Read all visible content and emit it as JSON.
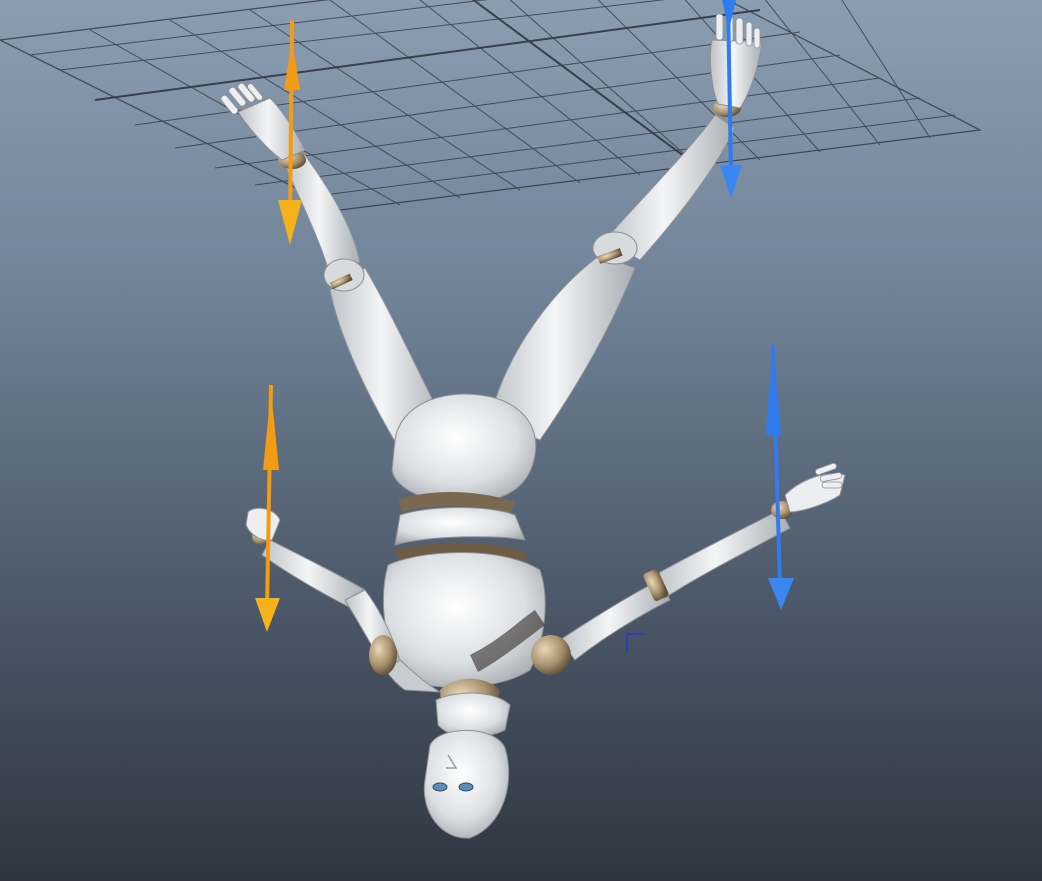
{
  "viewport": {
    "background_top": "#8b9db1",
    "background_bottom": "#2f3640",
    "grid_color": "#3a4048"
  },
  "figure": {
    "body_color": "#e6e8ea",
    "joint_color": "#8c7a62",
    "eye_color": "#5b8fb8"
  },
  "manipulators": {
    "left_side_color": "#f39b12",
    "right_side_color": "#2e7cf0"
  }
}
